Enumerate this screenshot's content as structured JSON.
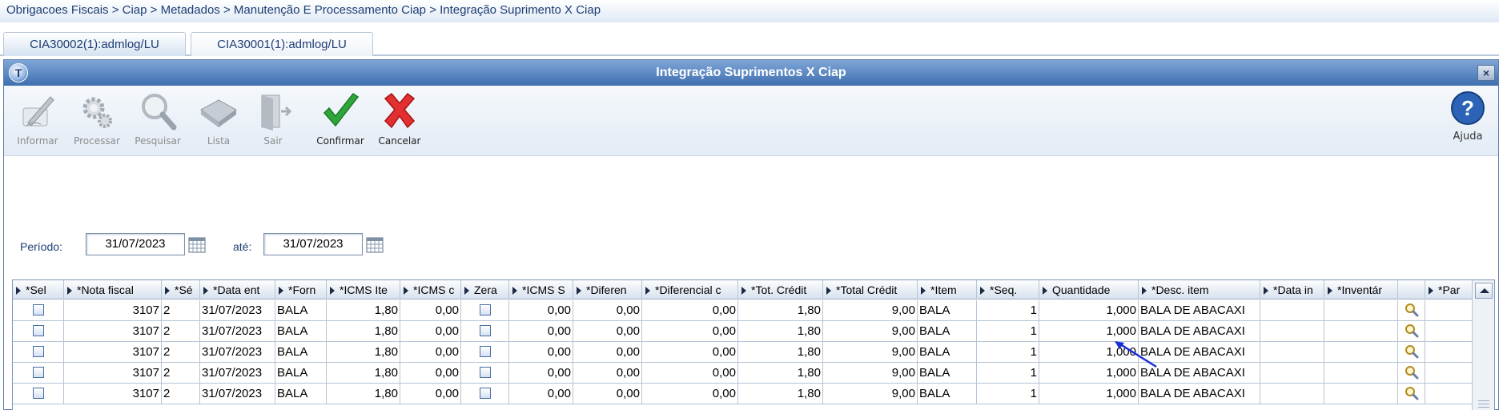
{
  "breadcrumb": "Obrigacoes Fiscais > Ciap > Metadados > Manutenção E Processamento Ciap > Integração Suprimento X Ciap",
  "tabs": [
    {
      "label": "CIA30002(1):admlog/LU"
    },
    {
      "label": "CIA30001(1):admlog/LU"
    }
  ],
  "window": {
    "title": "Integração Suprimentos X Ciap",
    "close_label": "×",
    "icon_letter": "T"
  },
  "toolbar": {
    "items": [
      {
        "label": "Informar",
        "icon": "pen-icon",
        "enabled": false
      },
      {
        "label": "Processar",
        "icon": "gears-icon",
        "enabled": false
      },
      {
        "label": "Pesquisar",
        "icon": "magnifier-icon",
        "enabled": false
      },
      {
        "label": "Lista",
        "icon": "book-icon",
        "enabled": false
      },
      {
        "label": "Sair",
        "icon": "exit-door-icon",
        "enabled": false
      },
      {
        "label": "Confirmar",
        "icon": "checkmark-icon",
        "enabled": true
      },
      {
        "label": "Cancelar",
        "icon": "cancel-x-icon",
        "enabled": true
      }
    ],
    "help_label": "Ajuda"
  },
  "period": {
    "label": "Período:",
    "from": "31/07/2023",
    "to_label": "até:",
    "to": "31/07/2023"
  },
  "grid": {
    "columns": [
      "*Sel",
      "*Nota fiscal",
      "*Sé",
      "*Data ent",
      "*Forn",
      "*ICMS Ite",
      "*ICMS c",
      "Zera",
      "*ICMS S",
      "*Diferen",
      "*Diferencial c",
      "*Tot. Crédit",
      "*Total Crédit",
      "*Item",
      "*Seq.",
      "Quantidade",
      "*Desc. item",
      "*Data in",
      "*Inventár",
      "",
      "*Par"
    ],
    "rows": [
      [
        "",
        "3107",
        "2",
        "31/07/2023",
        "BALA",
        "1,80",
        "0,00",
        "",
        "0,00",
        "0,00",
        "0,00",
        "1,80",
        "9,00",
        "BALA",
        "1",
        "1,000",
        "BALA DE ABACAXI",
        "",
        "",
        "",
        ""
      ],
      [
        "",
        "3107",
        "2",
        "31/07/2023",
        "BALA",
        "1,80",
        "0,00",
        "",
        "0,00",
        "0,00",
        "0,00",
        "1,80",
        "9,00",
        "BALA",
        "1",
        "1,000",
        "BALA DE ABACAXI",
        "",
        "",
        "",
        ""
      ],
      [
        "",
        "3107",
        "2",
        "31/07/2023",
        "BALA",
        "1,80",
        "0,00",
        "",
        "0,00",
        "0,00",
        "0,00",
        "1,80",
        "9,00",
        "BALA",
        "1",
        "1,000",
        "BALA DE ABACAXI",
        "",
        "",
        "",
        ""
      ],
      [
        "",
        "3107",
        "2",
        "31/07/2023",
        "BALA",
        "1,80",
        "0,00",
        "",
        "0,00",
        "0,00",
        "0,00",
        "1,80",
        "9,00",
        "BALA",
        "1",
        "1,000",
        "BALA DE ABACAXI",
        "",
        "",
        "",
        ""
      ],
      [
        "",
        "3107",
        "2",
        "31/07/2023",
        "BALA",
        "1,80",
        "0,00",
        "",
        "0,00",
        "0,00",
        "0,00",
        "1,80",
        "9,00",
        "BALA",
        "1",
        "1,000",
        "BALA DE ABACAXI",
        "",
        "",
        "",
        ""
      ]
    ]
  },
  "colors": {
    "titlebar": "#3f6fb0",
    "annotation_arrow": "#1a2fd6"
  }
}
